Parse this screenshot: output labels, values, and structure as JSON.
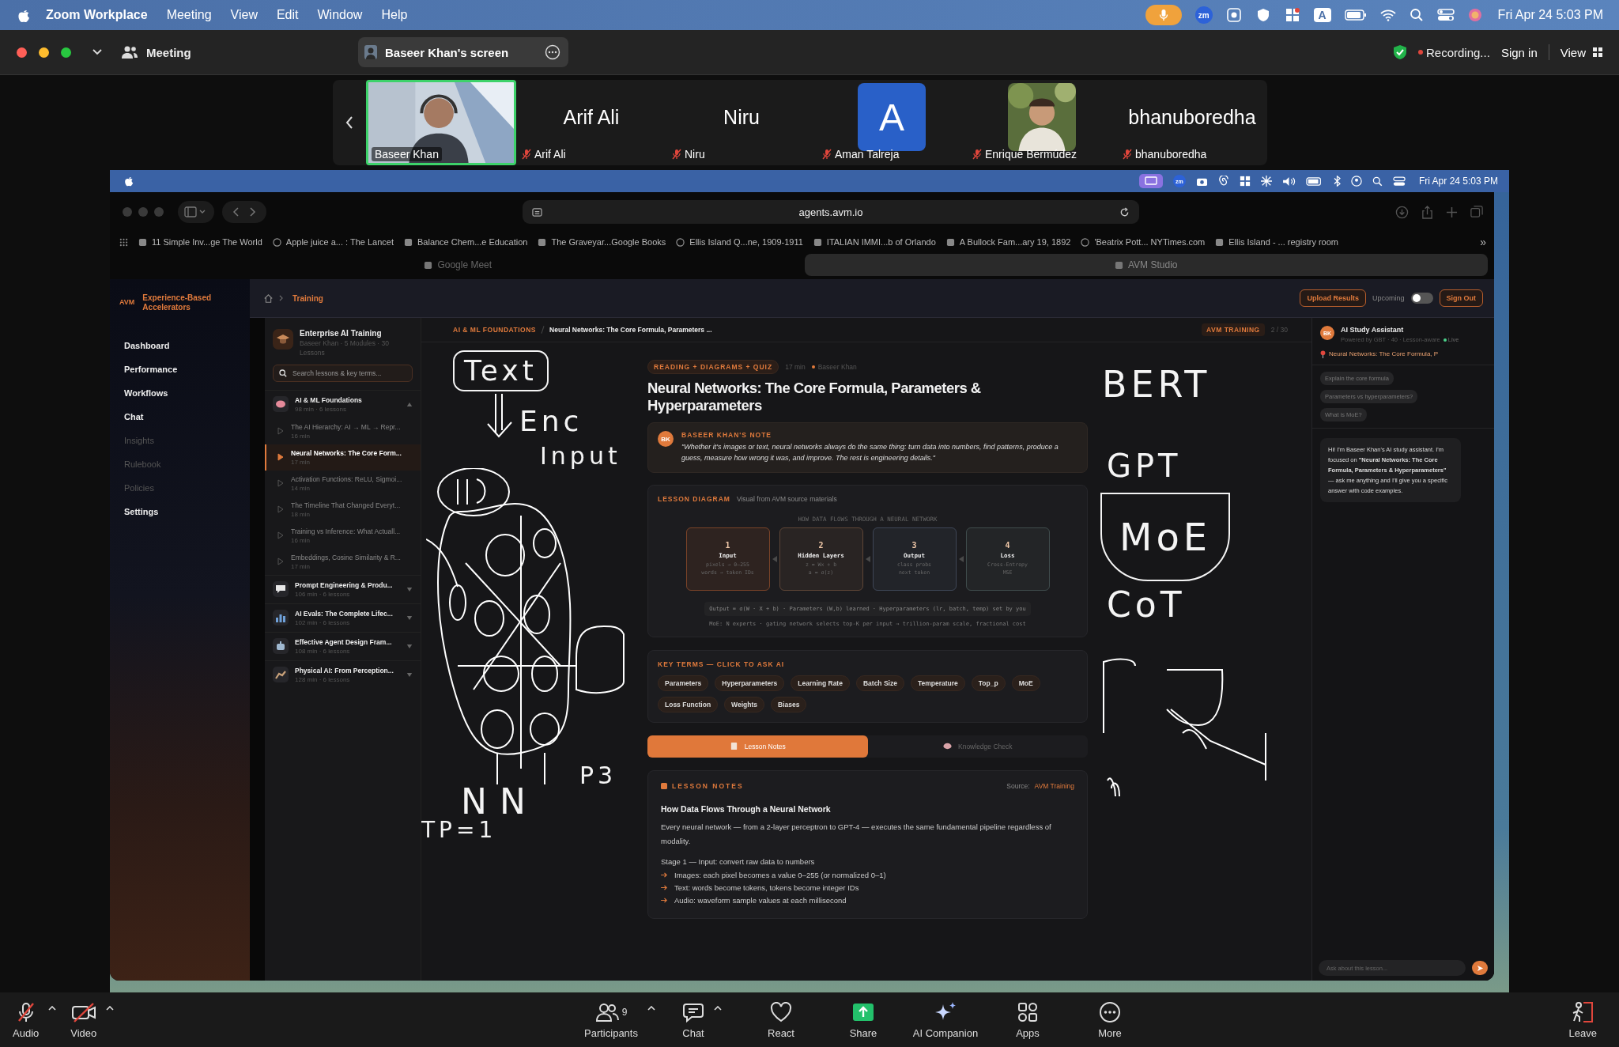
{
  "menu_bar": {
    "app_name": "Zoom Workplace",
    "items": [
      "Meeting",
      "View",
      "Edit",
      "Window",
      "Help"
    ],
    "zoom_badge": "zm",
    "input_source": "A",
    "clock": "Fri Apr 24  5:03 PM"
  },
  "meeting_bar": {
    "title": "Meeting",
    "screen_label": "Baseer Khan's screen",
    "recording": "Recording...",
    "sign_in": "Sign in",
    "view": "View"
  },
  "participants": [
    {
      "kind": "video",
      "name": "Baseer Khan",
      "muted": false,
      "selected": true
    },
    {
      "kind": "name",
      "display": "Arif Ali",
      "name": "Arif Ali",
      "muted": true,
      "selected": false
    },
    {
      "kind": "name",
      "display": "Niru",
      "name": "Niru",
      "muted": true,
      "selected": false
    },
    {
      "kind": "avatar",
      "initial": "A",
      "name": "Aman Talreja",
      "muted": true,
      "selected": false
    },
    {
      "name": "Enrique Bermúdez",
      "muted": true,
      "selected": false
    },
    {
      "kind": "name",
      "display": "bhanuboredha",
      "name": "bhanuboredha",
      "muted": true,
      "selected": false
    }
  ],
  "shared_screen": {
    "desktop_bar": {
      "zoom_badge": "zm",
      "clock": "Fri Apr 24  5:03 PM"
    },
    "browser": {
      "url": "agents.avm.io",
      "bookmarks": [
        "11 Simple Inv...ge The World",
        "Apple juice a... : The Lancet",
        "Balance Chem...e Education",
        "The Graveyar...Google Books",
        "Ellis Island Q...ne, 1909-1911",
        "ITALIAN IMMI...b of Orlando",
        "A Bullock Fam...ary 19, 1892",
        "'Beatrix Pott... NYTimes.com",
        "Ellis Island - ... registry room"
      ],
      "more": "»",
      "tabs": [
        {
          "label": "Google Meet",
          "selected": false
        },
        {
          "label": "AVM Studio",
          "selected": true
        }
      ]
    },
    "app": {
      "logo": "AVM",
      "brand": "Experience-Based Accelerators",
      "nav": [
        {
          "label": "Dashboard",
          "disabled": false
        },
        {
          "label": "Performance",
          "disabled": false
        },
        {
          "label": "Workflows",
          "disabled": false
        },
        {
          "label": "Chat",
          "disabled": false
        },
        {
          "label": "Insights",
          "disabled": true
        },
        {
          "label": "Rulebook",
          "disabled": true
        },
        {
          "label": "Policies",
          "disabled": true
        },
        {
          "label": "Settings",
          "disabled": false
        }
      ],
      "breadcrumb": "Training",
      "upload": "Upload Results",
      "upcoming": {
        "label": "Upcoming",
        "on": false
      },
      "sign_out": "Sign Out",
      "course": {
        "title": "Enterprise AI Training",
        "meta": "Baseer Khan · 5 Modules · 30 Lessons"
      },
      "search": {
        "placeholder": "Search lessons & key terms..."
      },
      "modules": [
        {
          "kind": "brain",
          "title": "AI & ML Foundations",
          "meta": "98 min · 6 lessons",
          "expanded": true,
          "lessons": [
            {
              "title": "The AI Hierarchy: AI → ML → Repr...",
              "duration": "16 min",
              "selected": false
            },
            {
              "title": "Neural Networks: The Core Form...",
              "duration": "17 min",
              "selected": true
            },
            {
              "title": "Activation Functions: ReLU, Sigmoi...",
              "duration": "14 min",
              "selected": false
            },
            {
              "title": "The Timeline That Changed Everyt...",
              "duration": "18 min",
              "selected": false
            },
            {
              "title": "Training vs Inference: What Actuall...",
              "duration": "16 min",
              "selected": false
            },
            {
              "title": "Embeddings, Cosine Similarity & R...",
              "duration": "17 min",
              "selected": false
            }
          ]
        },
        {
          "kind": "chat",
          "title": "Prompt Engineering & Produ...",
          "meta": "106 min · 6 lessons",
          "expanded": false
        },
        {
          "kind": "chart",
          "title": "AI Evals: The Complete Lifec...",
          "meta": "102 min · 6 lessons",
          "expanded": false
        },
        {
          "kind": "robot",
          "title": "Effective Agent Design Fram...",
          "meta": "108 min · 6 lessons",
          "expanded": false
        },
        {
          "kind": "arm",
          "title": "Physical AI: From Perception...",
          "meta": "128 min · 6 lessons",
          "expanded": false
        }
      ],
      "lesson_path": {
        "section": "AI & ML FOUNDATIONS",
        "lesson": "Neural Networks: The Core Formula, Parameters ...",
        "program": "AVM TRAINING",
        "position": "2 / 30"
      },
      "lesson": {
        "tag": "READING + DIAGRAMS + QUIZ",
        "duration": "17 min",
        "author": "Baseer Khan",
        "title": "Neural Networks: The Core Formula, Parameters & Hyperparameters",
        "note": {
          "avatar": "BK",
          "heading": "BASEER KHAN'S NOTE",
          "quote": "\"Whether it's images or text, neural networks always do the same thing: turn data into numbers, find patterns, produce a guess, measure how wrong it was, and improve. The rest is engineering details.\""
        },
        "diagram": {
          "heading": "LESSON DIAGRAM",
          "caption": "Visual from AVM source materials",
          "title": "HOW DATA FLOWS THROUGH A NEURAL NETWORK",
          "steps": [
            {
              "number": "1",
              "name": "Input",
              "lines": [
                "pixels → 0–255",
                "words → token IDs"
              ],
              "color": "#7a4328"
            },
            {
              "number": "2",
              "name": "Hidden Layers",
              "lines": [
                "z = Wx + b",
                "a = σ(z)"
              ],
              "color": "#5e4536"
            },
            {
              "number": "3",
              "name": "Output",
              "lines": [
                "class probs",
                "next token"
              ],
              "color": "#3e4656"
            },
            {
              "number": "4",
              "name": "Loss",
              "lines": [
                "Cross-Entropy",
                "MSE"
              ],
              "color": "#3f4c4c"
            }
          ],
          "formula": "Output = σ(W · X + b) · Parameters (W,b) learned · Hyperparameters (lr, batch, temp) set by you",
          "moe": "MoE: N experts · gating network selects top-K per input → trillion-param scale, fractional cost"
        },
        "key_terms": {
          "heading": "KEY TERMS — CLICK TO ASK AI",
          "terms": [
            "Parameters",
            "Hyperparameters",
            "Learning Rate",
            "Batch Size",
            "Temperature",
            "Top_p",
            "MoE",
            "Loss Function",
            "Weights",
            "Biases"
          ]
        },
        "tabs": [
          {
            "label": "Lesson Notes",
            "selected": true
          },
          {
            "label": "Knowledge Check",
            "selected": false
          }
        ],
        "notes": {
          "heading": "LESSON NOTES",
          "source_label": "Source:",
          "source": "AVM Training",
          "title": "How Data Flows Through a Neural Network",
          "paragraph": "Every neural network — from a 2-layer perceptron to GPT-4 — executes the same fundamental pipeline regardless of modality.",
          "stage": "Stage 1 — Input: convert raw data to numbers",
          "bullets": [
            "Images: each pixel becomes a value 0–255 (or normalized 0–1)",
            "Text: words become tokens, tokens become integer IDs",
            "Audio: waveform sample values at each millisecond"
          ]
        }
      },
      "assistant": {
        "avatar": "BK",
        "title": "AI Study Assistant",
        "subtitle": "Powered by GBT · 40 · Lesson-aware",
        "live": "Live",
        "context": "Neural Networks: The Core Formula, P",
        "suggestions": [
          "Explain the core formula",
          "Parameters vs hyperparameters?",
          "What is MoE?"
        ],
        "message": "Hi! I'm Baseer Khan's AI study assistant. I'm focused on **\"Neural Networks: The Core Formula, Parameters & Hyperparameters\"** — ask me anything and I'll give you a specific answer with code examples.",
        "input_placeholder": "Ask about this lesson..."
      }
    },
    "annotations": {
      "left": [
        {
          "text": "Text",
          "boxed": true
        },
        {
          "text": "Enc",
          "boxed": false
        },
        {
          "text": "Input",
          "boxed": false
        },
        {
          "text": "NN",
          "boxed": false
        },
        {
          "text": "P3",
          "boxed": false
        },
        {
          "text": "TP=1",
          "boxed": false
        }
      ],
      "right": [
        {
          "text": "BERT",
          "boxed": false
        },
        {
          "text": "GPT",
          "boxed": false
        },
        {
          "text": "MoE",
          "boxed": true
        },
        {
          "text": "CoT",
          "boxed": false
        }
      ]
    }
  },
  "toolbar": [
    {
      "kind": "audio",
      "label": "Audio",
      "muted": true,
      "menu": true
    },
    {
      "kind": "video",
      "label": "Video",
      "muted": true,
      "menu": true
    },
    {
      "kind": "participants",
      "label": "Participants",
      "count": "9",
      "menu": true
    },
    {
      "kind": "chat",
      "label": "Chat",
      "menu": true
    },
    {
      "kind": "react",
      "label": "React"
    },
    {
      "kind": "share",
      "label": "Share"
    },
    {
      "kind": "ai",
      "label": "AI Companion"
    },
    {
      "kind": "apps",
      "label": "Apps"
    },
    {
      "kind": "more",
      "label": "More"
    },
    {
      "kind": "leave",
      "label": "Leave"
    }
  ]
}
